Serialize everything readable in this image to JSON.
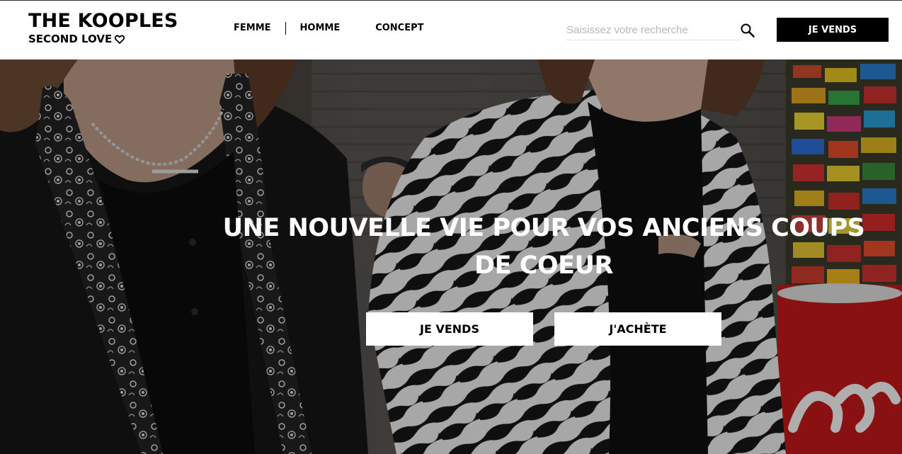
{
  "brand": {
    "name": "THE KOOPLES",
    "tagline": "SECOND LOVE"
  },
  "nav": {
    "items": [
      {
        "label": "FEMME"
      },
      {
        "label": "HOMME"
      },
      {
        "label": "CONCEPT"
      }
    ]
  },
  "search": {
    "placeholder": "Saisissez votre recherche",
    "value": ""
  },
  "header": {
    "sell_label": "JE VENDS"
  },
  "hero": {
    "title": "UNE NOUVELLE VIE POUR VOS ANCIENS COUPS DE COEUR",
    "sell_label": "JE VENDS",
    "buy_label": "J'ACHÈTE"
  },
  "colors": {
    "header_bg": "#ffffff",
    "accent": "#000000",
    "hero_text": "#ffffff"
  },
  "icons": [
    "heart-icon",
    "search-icon"
  ]
}
